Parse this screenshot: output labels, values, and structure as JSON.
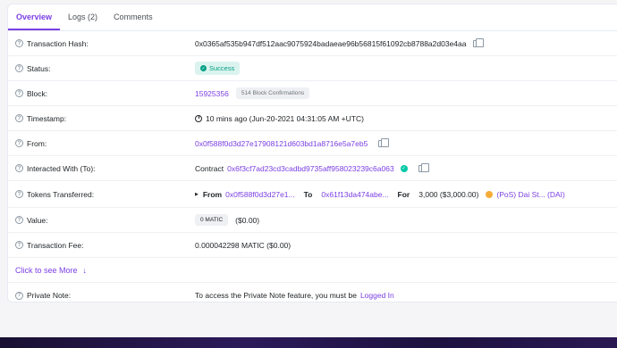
{
  "tabs": [
    {
      "label": "Overview"
    },
    {
      "label": "Logs (2)"
    },
    {
      "label": "Comments"
    }
  ],
  "rows": {
    "tx_hash": {
      "label": "Transaction Hash:",
      "value": "0x0365af535b947df512aac9075924badaeae96b56815f61092cb8788a2d03e4aa"
    },
    "status": {
      "label": "Status:",
      "value": "Success"
    },
    "block": {
      "label": "Block:",
      "value": "15925356",
      "confirmations": "514 Block Confirmations"
    },
    "timestamp": {
      "label": "Timestamp:",
      "value": "10 mins ago (Jun-20-2021 04:31:05 AM +UTC)"
    },
    "from": {
      "label": "From:",
      "value": "0x0f588f0d3d27e17908121d603bd1a8716e5a7eb5"
    },
    "to": {
      "label": "Interacted With (To):",
      "prefix": "Contract",
      "value": "0x6f3cf7ad23cd3cadbd9735aff958023239c6a063"
    },
    "tokens": {
      "label": "Tokens Transferred:",
      "from_label": "From",
      "from_value": "0x0f588f0d3d27e1...",
      "to_label": "To",
      "to_value": "0x61f13da474abe...",
      "for_label": "For",
      "amount": "3,000 ($3,000.00)",
      "token": "(PoS) Dai St... (DAI)"
    },
    "value": {
      "label": "Value:",
      "amount": "0 MATIC",
      "usd": "($0.00)"
    },
    "fee": {
      "label": "Transaction Fee:",
      "value": "0.000042298 MATIC ($0.00)"
    },
    "see_more": {
      "label": "Click to see More",
      "arrow": "↓"
    },
    "private_note": {
      "label": "Private Note:",
      "text": "To access the Private Note feature, you must be",
      "link": "Logged In"
    }
  },
  "colors": {
    "accent": "#7b3fe4",
    "success": "#00a186",
    "footer": "#1d1240"
  },
  "icons": {
    "help": "question-circle-icon",
    "copy": "copy-icon",
    "clock": "clock-icon",
    "check": "check-circle-icon",
    "coin": "dai-token-icon"
  }
}
